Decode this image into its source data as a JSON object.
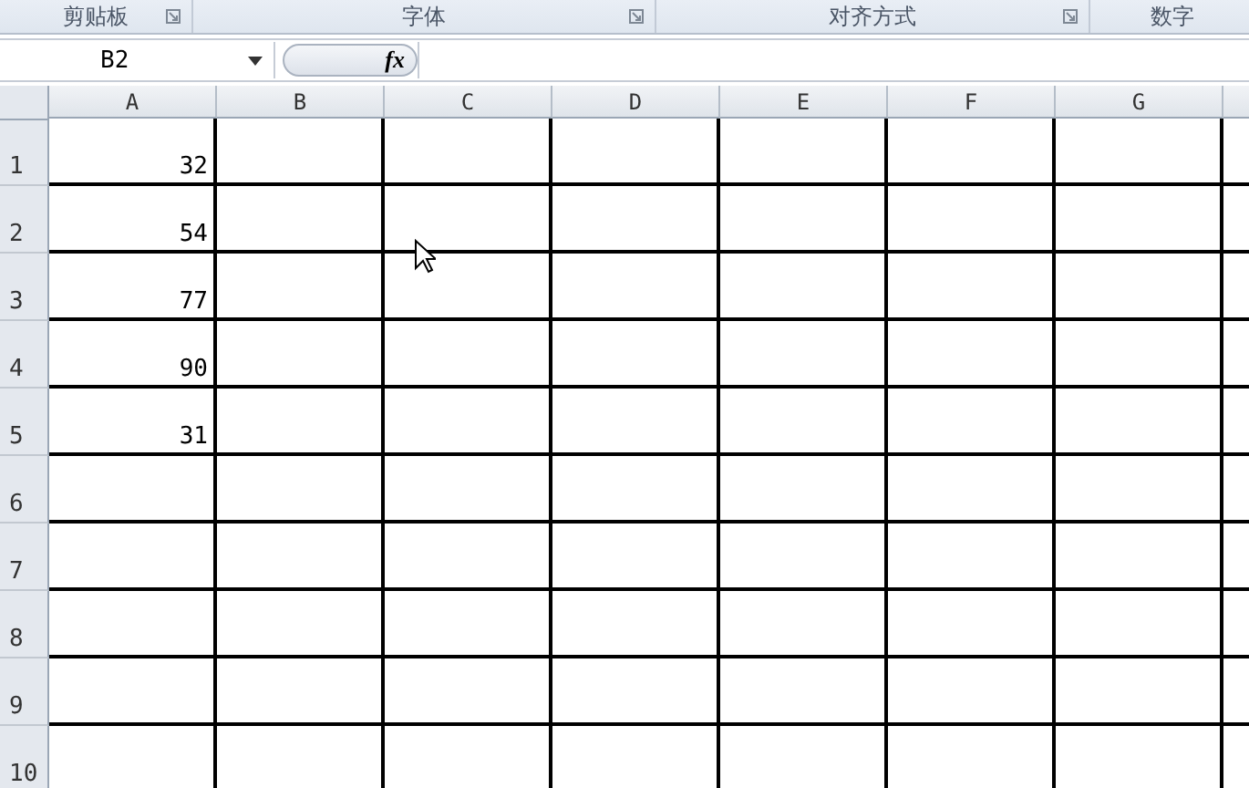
{
  "ribbon_groups": [
    {
      "label": "剪贴板"
    },
    {
      "label": "字体"
    },
    {
      "label": "对齐方式"
    },
    {
      "label": "数字"
    }
  ],
  "formula_bar": {
    "name_box": "B2",
    "function_label": "fx"
  },
  "columns": [
    "A",
    "B",
    "C",
    "D",
    "E",
    "F",
    "G"
  ],
  "rows": [
    {
      "number": "1",
      "cells": [
        "32",
        "",
        "",
        "",
        "",
        "",
        ""
      ]
    },
    {
      "number": "2",
      "cells": [
        "54",
        "",
        "",
        "",
        "",
        "",
        ""
      ]
    },
    {
      "number": "3",
      "cells": [
        "77",
        "",
        "",
        "",
        "",
        "",
        ""
      ]
    },
    {
      "number": "4",
      "cells": [
        "90",
        "",
        "",
        "",
        "",
        "",
        ""
      ]
    },
    {
      "number": "5",
      "cells": [
        "31",
        "",
        "",
        "",
        "",
        "",
        ""
      ]
    },
    {
      "number": "6",
      "cells": [
        "",
        "",
        "",
        "",
        "",
        "",
        ""
      ]
    },
    {
      "number": "7",
      "cells": [
        "",
        "",
        "",
        "",
        "",
        "",
        ""
      ]
    },
    {
      "number": "8",
      "cells": [
        "",
        "",
        "",
        "",
        "",
        "",
        ""
      ]
    },
    {
      "number": "9",
      "cells": [
        "",
        "",
        "",
        "",
        "",
        "",
        ""
      ]
    },
    {
      "number": "10",
      "cells": [
        "",
        "",
        "",
        "",
        "",
        "",
        ""
      ]
    }
  ]
}
